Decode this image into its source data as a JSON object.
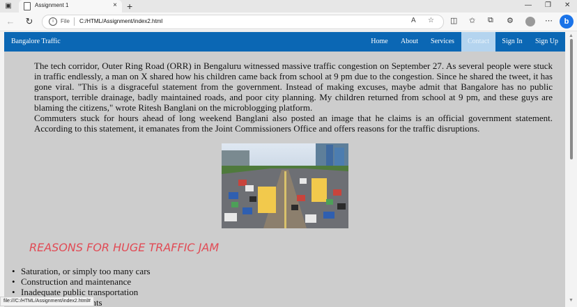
{
  "browser": {
    "tab_title": "Assignment 1",
    "tab_close": "×",
    "new_tab": "+",
    "address_protocol": "File",
    "address_url": "C:/HTML/Assignment/index2.html",
    "status_url": "file:///C:/HTML/Assignment/index2.html#"
  },
  "nav": {
    "brand": "Bangalore Traffic",
    "items": [
      {
        "label": "Home"
      },
      {
        "label": "About"
      },
      {
        "label": "Services"
      },
      {
        "label": "Contact",
        "active": true
      },
      {
        "label": "Sign In"
      },
      {
        "label": "Sign Up"
      }
    ]
  },
  "article": {
    "paragraph1": "The tech corridor, Outer Ring Road (ORR) in Bengaluru witnessed massive traffic congestion on September 27. As several people were stuck in traffic endlessly, a man on X shared how his children came back from school at 9 pm due to the congestion. Since he shared the tweet, it has gone viral. \"This is a disgraceful statement from the government. Instead of making excuses, maybe admit that Bangalore has no public transport, terrible drainage, badly maintained roads, and poor city planning. My children returned from school at 9 pm, and these guys are blaming the citizens,\" wrote Ritesh Banglani on the microblogging platform.",
    "paragraph2": "Commuters stuck for hours ahead of long weekend Banglani also posted an image that he claims is an official government statement. According to this statement, it emanates from the Joint Commissioners Office and offers reasons for the traffic disruptions."
  },
  "section": {
    "heading": "REASONS FOR HUGE TRAFFIC JAM",
    "reasons": [
      "Saturation, or simply too many cars",
      "Construction and maintenance",
      "Inadequate public transportation",
      "Weather and accidents"
    ]
  },
  "colors": {
    "navbar": "#0b67b4",
    "active_nav": "#b4d4ef",
    "heading": "#e14b55",
    "page_bg": "#cdcdcd"
  }
}
